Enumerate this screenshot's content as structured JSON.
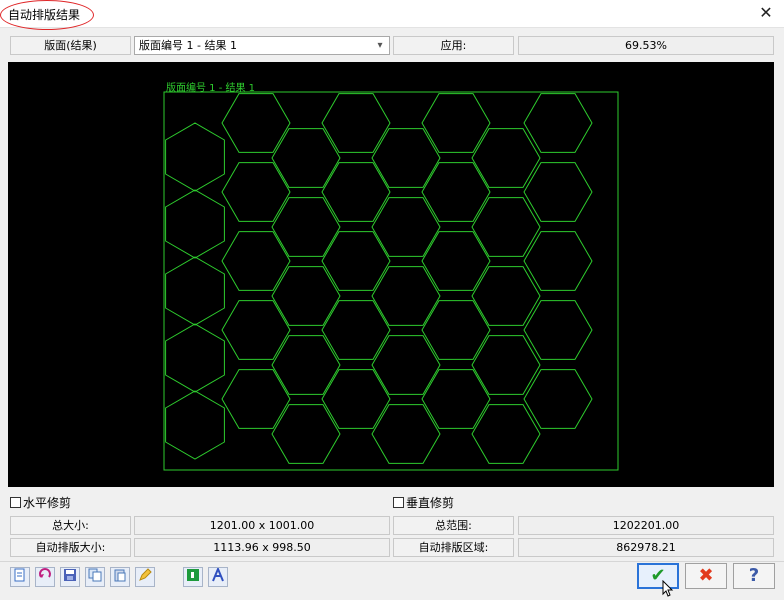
{
  "window": {
    "title": "自动排版结果",
    "close_glyph": "✕"
  },
  "top_row": {
    "sheet_label": "版面(结果)",
    "sheet_select": "版面编号 1 - 结果 1",
    "apply_label": "应用:",
    "apply_value": "69.53%"
  },
  "canvas": {
    "sheet_caption": "版面编号 1 - 结果 1",
    "background": "#000000",
    "line_color": "#2ecc2e"
  },
  "trim": {
    "horizontal": "水平修剪",
    "vertical": "垂直修剪"
  },
  "stats": {
    "total_size_label": "总大小:",
    "total_size_value": "1201.00 x 1001.00",
    "total_range_label": "总范围:",
    "total_range_value": "1202201.00",
    "nest_size_label": "自动排版大小:",
    "nest_size_value": "1113.96 x 998.50",
    "nest_area_label": "自动排版区域:",
    "nest_area_value": "862978.21"
  },
  "toolbar": {
    "icons": [
      "new-icon",
      "undo-icon",
      "save-icon",
      "copy-icon",
      "paste-icon",
      "pencil-icon",
      "green-square-icon",
      "letter-a-icon"
    ],
    "ok_glyph": "✔",
    "cancel_glyph": "✖",
    "help_glyph": "?"
  }
}
